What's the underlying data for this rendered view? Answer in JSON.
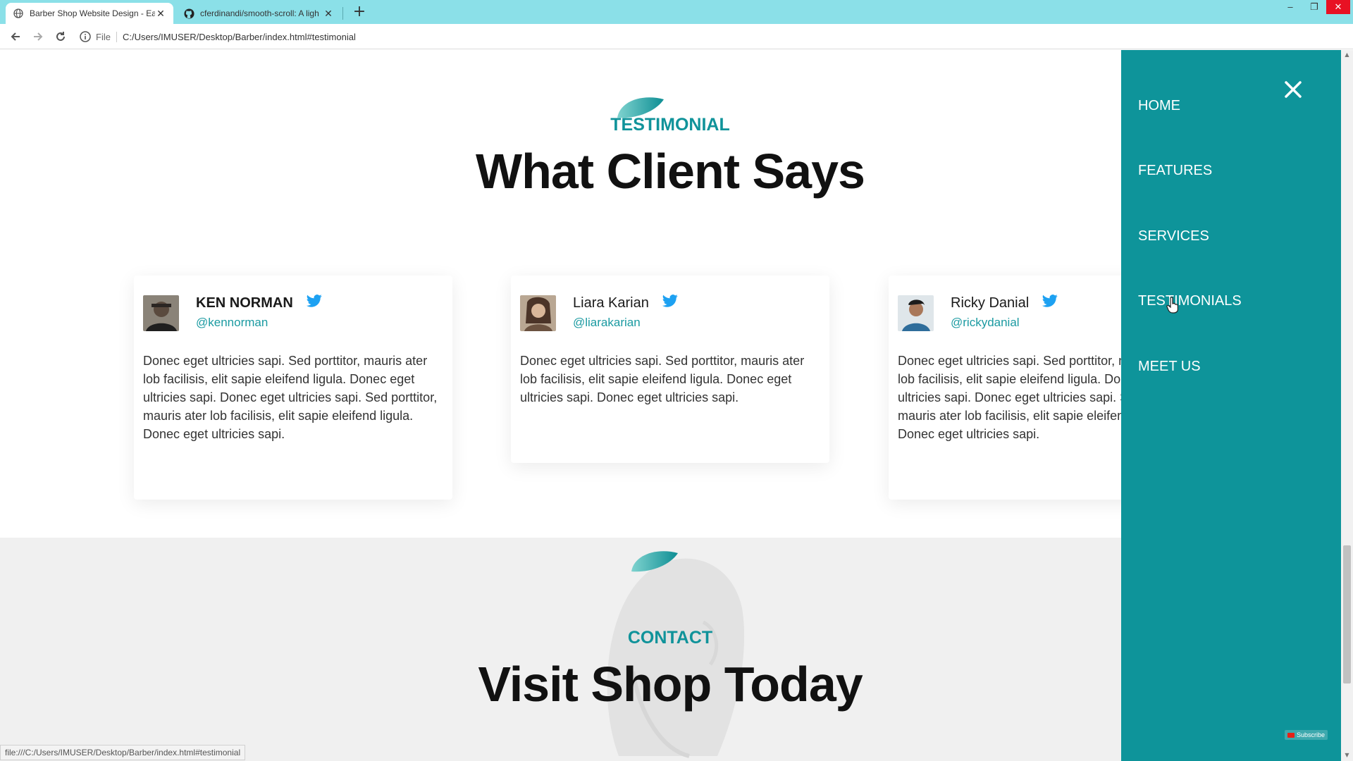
{
  "browser": {
    "tabs": [
      {
        "title": "Barber Shop Website Design - Ea",
        "active": true
      },
      {
        "title": "cferdinandi/smooth-scroll: A ligh",
        "active": false
      }
    ],
    "new_tab_label": "+",
    "address": {
      "scheme": "File",
      "url": "C:/Users/IMUSER/Desktop/Barber/index.html#testimonial"
    },
    "status_url": "file:///C:/Users/IMUSER/Desktop/Barber/index.html#testimonial"
  },
  "testimonial": {
    "tag": "TESTIMONIAL",
    "title": "What Client Says",
    "cards": [
      {
        "name": "KEN NORMAN",
        "handle": "@kennorman",
        "text": "Donec eget ultricies sapi. Sed porttitor, mauris ater lob facilisis, elit sapie eleifend ligula. Donec eget ultricies sapi. Donec eget ultricies sapi. Sed porttitor, mauris ater lob facilisis, elit sapie eleifend ligula. Donec eget ultricies sapi."
      },
      {
        "name": "Liara Karian",
        "handle": "@liarakarian",
        "text": "Donec eget ultricies sapi. Sed porttitor, mauris ater lob facilisis, elit sapie eleifend ligula. Donec eget ultricies sapi. Donec eget ultricies sapi."
      },
      {
        "name": "Ricky Danial",
        "handle": "@rickydanial",
        "text": "Donec eget ultricies sapi. Sed porttitor, mauris ater lob facilisis, elit sapie eleifend ligula. Donec eget ultricies sapi. Donec eget ultricies sapi. Sed porttitor, mauris ater lob facilisis, elit sapie eleifend ligula. Donec eget ultricies sapi."
      }
    ]
  },
  "contact": {
    "tag": "CONTACT",
    "title": "Visit Shop Today"
  },
  "sidenav": {
    "items": [
      {
        "label": "HOME"
      },
      {
        "label": "FEATURES"
      },
      {
        "label": "SERVICES"
      },
      {
        "label": "TESTIMONIALS"
      },
      {
        "label": "MEET US"
      }
    ]
  },
  "overlay": {
    "subscribe_label": "Subscribe"
  },
  "colors": {
    "accent": "#0e949a",
    "tab_bar": "#8be0e8",
    "twitter": "#1da1f2"
  },
  "icons": [
    "globe-icon",
    "github-icon",
    "back-arrow-icon",
    "forward-arrow-icon",
    "reload-icon",
    "info-icon",
    "star-icon",
    "twitter-icon",
    "close-icon",
    "leaf-icon",
    "cursor-icon"
  ]
}
